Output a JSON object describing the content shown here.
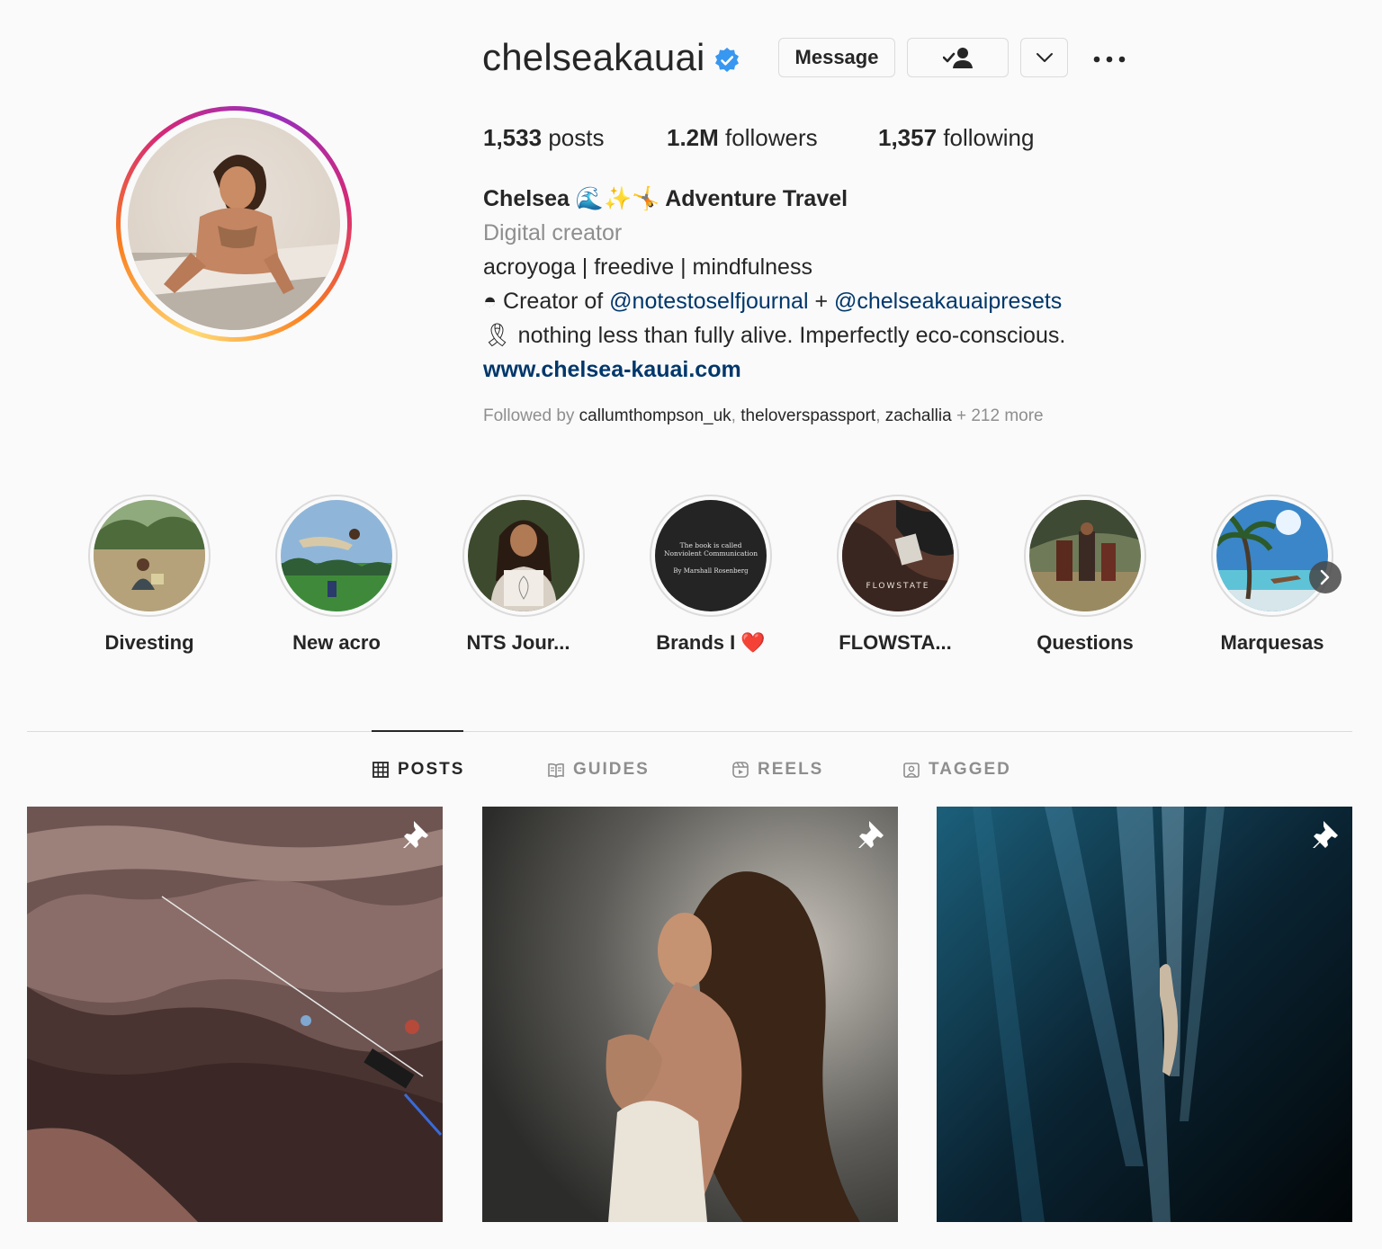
{
  "profile": {
    "username": "chelseakauai",
    "verified": true,
    "buttons": {
      "message_label": "Message",
      "following_icon": "person-check-icon",
      "suggest_icon": "chevron-down-icon",
      "more_icon": "more-dots-icon"
    },
    "stats": {
      "posts_value": "1,533",
      "posts_label": "posts",
      "followers_value": "1.2M",
      "followers_label": "followers",
      "following_value": "1,357",
      "following_label": "following"
    },
    "bio": {
      "name": "Chelsea 🌊✨🤸 Adventure Travel",
      "category": "Digital creator",
      "line1": "acroyoga | freedive | mindfulness",
      "line2_prefix": "◓ Creator of ",
      "line2_mention1": "@notestoselfjournal",
      "line2_plus": " + ",
      "line2_mention2": "@chelseakauaipresets",
      "line3": "🎗 nothing less than fully alive. Imperfectly eco-conscious.",
      "link": "www.chelsea-kauai.com"
    },
    "followed_by": {
      "prefix": "Followed by ",
      "user1": "callumthompson_uk",
      "sep1": ", ",
      "user2": "theloverspassport",
      "sep2": ", ",
      "user3": "zachallia",
      "suffix": " + 212 more"
    }
  },
  "highlights": [
    {
      "label": "Divesting"
    },
    {
      "label": "New acro"
    },
    {
      "label": "NTS Jour..."
    },
    {
      "label": "Brands I ❤️"
    },
    {
      "label": "FLOWSTA..."
    },
    {
      "label": "Questions"
    },
    {
      "label": "Marquesas"
    }
  ],
  "highlight_texts": {
    "brands_line1": "The book is called",
    "brands_line2": "Nonviolent Communication",
    "brands_line3": "By Marshall Rosenberg",
    "flowstate": "FLOWSTATE"
  },
  "tabs": [
    {
      "label": "POSTS",
      "icon": "grid-icon",
      "active": true
    },
    {
      "label": "GUIDES",
      "icon": "guide-icon",
      "active": false
    },
    {
      "label": "REELS",
      "icon": "reels-icon",
      "active": false
    },
    {
      "label": "TAGGED",
      "icon": "tagged-icon",
      "active": false
    }
  ],
  "posts": [
    {
      "pinned": true
    },
    {
      "pinned": true
    },
    {
      "pinned": true
    }
  ],
  "colors": {
    "background": "#fafafa",
    "text": "#262626",
    "secondary": "#8e8e8e",
    "link": "#00376b",
    "verified": "#3897f0",
    "border": "#dbdbdb"
  }
}
